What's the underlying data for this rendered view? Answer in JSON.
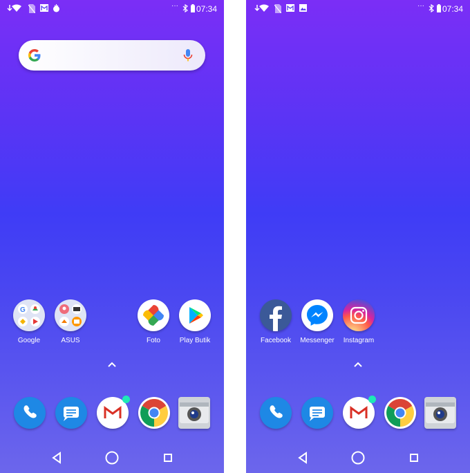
{
  "screens": {
    "left": {
      "time": "07:34",
      "status_icons": [
        "download-arrow-icon",
        "wifi-icon",
        "no-sim-icon",
        "gmail-notification-icon",
        "tomato-icon"
      ],
      "status_right": [
        "more-dots-icon",
        "bluetooth-icon",
        "battery-icon"
      ],
      "search_bar": {
        "icons": [
          "google-g-icon",
          "microphone-icon"
        ]
      },
      "apps": [
        {
          "label": "Google",
          "icon": "google-folder-icon"
        },
        {
          "label": "ASUS",
          "icon": "asus-folder-icon"
        },
        {
          "label": "Foto",
          "icon": "google-photos-icon"
        },
        {
          "label": "Play Butik",
          "icon": "play-store-icon"
        }
      ]
    },
    "right": {
      "time": "07:34",
      "status_icons": [
        "download-arrow-icon",
        "wifi-icon",
        "no-sim-icon",
        "gmail-notification-icon",
        "image-notification-icon"
      ],
      "status_right": [
        "more-dots-icon",
        "bluetooth-icon",
        "battery-icon"
      ],
      "apps": [
        {
          "label": "Facebook",
          "icon": "facebook-icon"
        },
        {
          "label": "Messenger",
          "icon": "messenger-icon"
        },
        {
          "label": "Instagram",
          "icon": "instagram-icon"
        }
      ]
    }
  },
  "dock": [
    "phone-icon",
    "messages-icon",
    "gmail-icon",
    "chrome-icon",
    "camera-icon"
  ],
  "navbar": [
    "back-icon",
    "home-icon",
    "recents-icon"
  ],
  "colors": {
    "wallpaper_top": "#7b2ef6",
    "wallpaper_mid": "#3f3cf6",
    "wallpaper_bottom": "#6c66ec",
    "dock_blue": "#1e88e5",
    "gmail_red": "#d93025",
    "notification_dot": "#1de9b6"
  }
}
